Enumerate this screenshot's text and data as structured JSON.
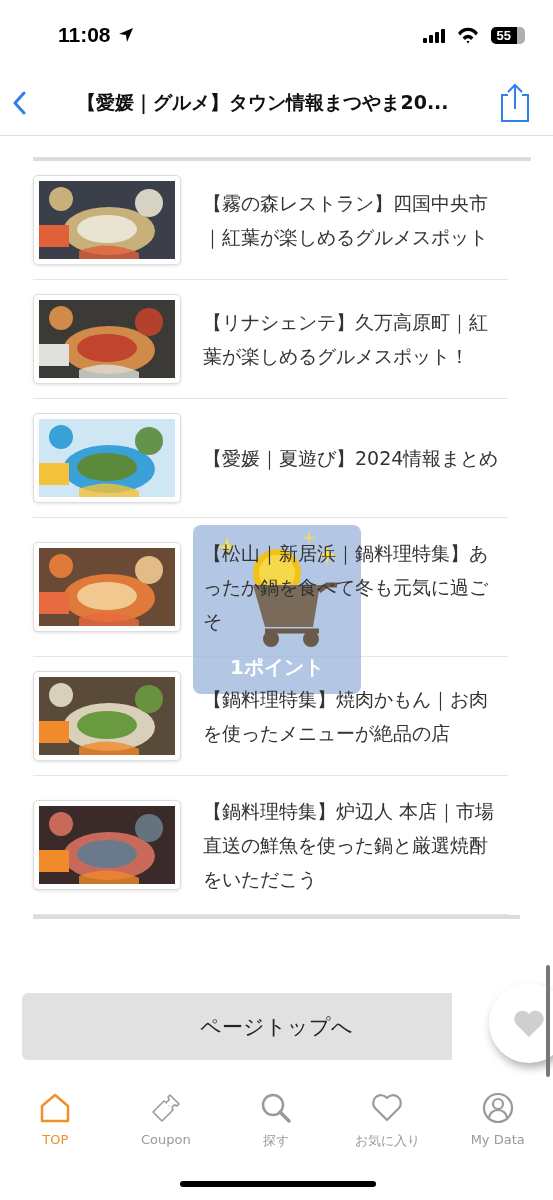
{
  "status_bar": {
    "time": "11:08",
    "battery": "55"
  },
  "nav": {
    "title": "【愛媛｜グルメ】タウン情報まつやま20..."
  },
  "articles": [
    {
      "title": "【霧の森レストラン】四国中央市｜紅葉が楽しめるグルメスポット"
    },
    {
      "title": "【リナシェンテ】久万高原町｜紅葉が楽しめるグルメスポット！"
    },
    {
      "title": "【愛媛｜夏遊び】2024情報まとめ"
    },
    {
      "title": "【松山｜新居浜｜鍋料理特集】あったか鍋を食べて冬も元気に過ごそ"
    },
    {
      "title": "【鍋料理特集】焼肉かもん｜お肉を使ったメニューが絶品の店"
    },
    {
      "title": "【鍋料理特集】炉辺人 本店｜市場直送の鮮魚を使った鍋と厳選焼酎をいただこう"
    }
  ],
  "point_popup": {
    "label": "1ポイント"
  },
  "page_top_button": {
    "label": "ページトップへ"
  },
  "tab_bar": [
    {
      "label": "TOP",
      "selected": true
    },
    {
      "label": "Coupon",
      "selected": false
    },
    {
      "label": "探す",
      "selected": false
    },
    {
      "label": "お気に入り",
      "selected": false
    },
    {
      "label": "My Data",
      "selected": false
    }
  ]
}
